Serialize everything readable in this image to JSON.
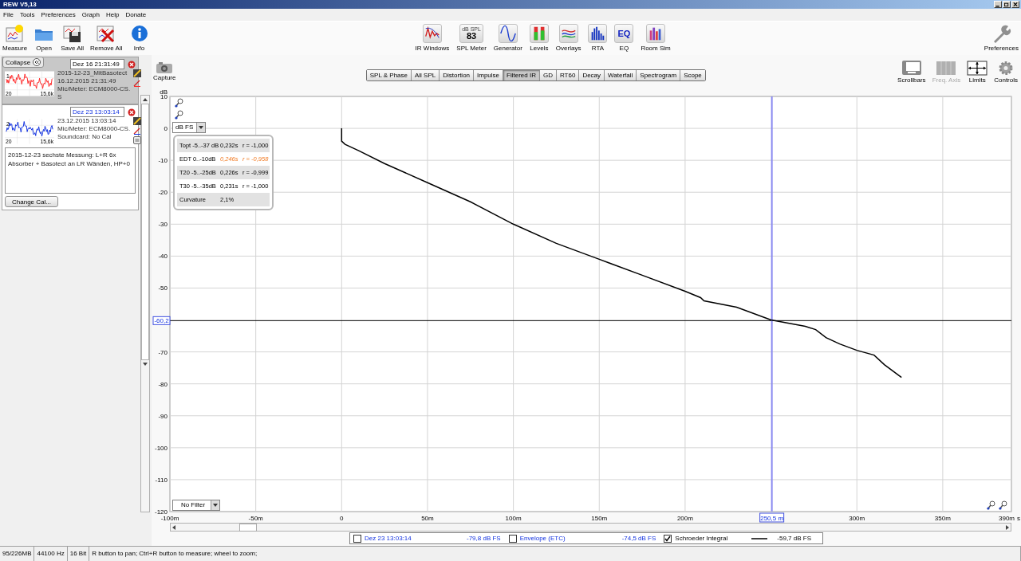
{
  "window": {
    "title": "REW V5,13"
  },
  "menu": [
    "File",
    "Tools",
    "Preferences",
    "Graph",
    "Help",
    "Donate"
  ],
  "toolbar": {
    "left": [
      {
        "label": "Measure"
      },
      {
        "label": "Open"
      },
      {
        "label": "Save All"
      },
      {
        "label": "Remove All"
      },
      {
        "label": "Info"
      }
    ],
    "center": [
      {
        "label": "IR Windows"
      },
      {
        "label": "SPL Meter",
        "icon_text": [
          "dB SPL",
          "83"
        ]
      },
      {
        "label": "Generator"
      },
      {
        "label": "Levels"
      },
      {
        "label": "Overlays"
      },
      {
        "label": "RTA"
      },
      {
        "label": "EQ",
        "icon_text": [
          "EQ"
        ]
      },
      {
        "label": "Room Sim"
      }
    ],
    "right": [
      {
        "label": "Preferences"
      }
    ]
  },
  "capture": {
    "label": "Capture"
  },
  "graph_tabs": [
    {
      "label": "SPL & Phase",
      "selected": false
    },
    {
      "label": "All SPL",
      "selected": false
    },
    {
      "label": "Distortion",
      "selected": false
    },
    {
      "label": "Impulse",
      "selected": false
    },
    {
      "label": "Filtered IR",
      "selected": true
    },
    {
      "label": "GD",
      "selected": false
    },
    {
      "label": "RT60",
      "selected": false
    },
    {
      "label": "Decay",
      "selected": false
    },
    {
      "label": "Waterfall",
      "selected": false
    },
    {
      "label": "Spectrogram",
      "selected": false
    },
    {
      "label": "Scope",
      "selected": false
    }
  ],
  "graph_tools": [
    {
      "label": "Scrollbars",
      "disabled": false
    },
    {
      "label": "Freq. Axis",
      "disabled": true
    },
    {
      "label": "Limits",
      "disabled": false
    },
    {
      "label": "Controls",
      "disabled": false
    }
  ],
  "measurements": {
    "collapse": "Collapse",
    "items": [
      {
        "name": "Dez 16 21:31:49",
        "selected": false,
        "color": "#ff2828",
        "index": "1",
        "axis_start": "20",
        "axis_end": "15,6k",
        "lines": [
          "2015-12-23_MitBasotect",
          "16.12.2015 21:31:49",
          "Mic/Meter: ECM8000-CS.",
          "S"
        ]
      },
      {
        "name": "Dez 23 13:03:14",
        "selected": true,
        "color": "#1030e0",
        "index": "2",
        "axis_start": "20",
        "axis_end": "15,6k",
        "lines": [
          "23.12.2015 13:03:14",
          "Mic/Meter: ECM8000-CS.",
          "Soundcard: No Cal"
        ],
        "notes": "2015-12-23 sechste Messung: L+R 6x Absorber + Basotect an LR  Wänden, HP+0",
        "change_cal": "Change Cal..."
      }
    ]
  },
  "graph": {
    "unit_selector": "dB FS",
    "filter_selector": "No Filter",
    "results": [
      {
        "label": "Topt -5..-37 dB",
        "time": "0,232s",
        "r": "r = -1,000",
        "warning": false
      },
      {
        "label": "EDT  0..-10dB",
        "time": "0,246s",
        "r": "r = -0,958",
        "warning": true
      },
      {
        "label": "T20 -5..-25dB",
        "time": "0,226s",
        "r": "r = -0,999",
        "warning": false
      },
      {
        "label": "T30 -5..-35dB",
        "time": "0,231s",
        "r": "r = -1,000",
        "warning": false
      },
      {
        "label": "Curvature",
        "time": "2,1%",
        "warning": false
      }
    ],
    "chart_data": {
      "type": "line",
      "xlabel": "s",
      "ylabel": "dB",
      "xlim": [
        -100,
        390
      ],
      "ylim": [
        -120,
        10
      ],
      "xticks": [
        {
          "value": -100,
          "label": "-100m"
        },
        {
          "value": -50,
          "label": "-50m"
        },
        {
          "value": 0,
          "label": "0"
        },
        {
          "value": 50,
          "label": "50m"
        },
        {
          "value": 100,
          "label": "100m"
        },
        {
          "value": 150,
          "label": "150m"
        },
        {
          "value": 200,
          "label": "200m"
        },
        {
          "value": 300,
          "label": "300m"
        },
        {
          "value": 350,
          "label": "350m"
        },
        {
          "value": 390,
          "label": "390m"
        }
      ],
      "yticks": [
        10,
        0,
        -10,
        -20,
        -30,
        -40,
        -50,
        -70,
        -80,
        -90,
        -100,
        -110,
        -120
      ],
      "x": [
        0,
        0,
        2,
        10,
        25,
        50,
        75,
        100,
        125,
        150,
        175,
        200,
        209,
        211,
        230,
        250,
        260,
        270,
        276,
        282,
        290,
        300,
        310,
        316,
        326
      ],
      "grid": true,
      "series": [
        {
          "color": "#000000",
          "values": [
            0,
            -4,
            -5,
            -7,
            -11,
            -17,
            -23,
            -30,
            -36,
            -41,
            -46,
            -51,
            -53,
            -54,
            -56,
            -60,
            -61,
            -62,
            -63,
            -65.5,
            -67.5,
            -69.5,
            -71,
            -74,
            -78
          ]
        }
      ],
      "ref_lines": [
        {
          "axis": "x",
          "value": 250.5,
          "label": "250,5 m"
        },
        {
          "axis": "y",
          "value": -60.2,
          "label": "-60,2"
        }
      ]
    }
  },
  "legend": [
    {
      "label": "Dez 23 13:03:14",
      "checked": false,
      "value": "-79,8 dB FS",
      "kind": "plain"
    },
    {
      "label": "Envelope (ETC)",
      "checked": false,
      "value": "-74,5 dB FS",
      "kind": "plain"
    },
    {
      "label": "Schroeder Integral",
      "checked": true,
      "value": "-59,7 dB FS",
      "kind": "line"
    }
  ],
  "status_bar": [
    "95/226MB",
    "44100 Hz",
    "16 Bit",
    "R button to pan; Ctrl+R button to measure; wheel to zoom;"
  ]
}
